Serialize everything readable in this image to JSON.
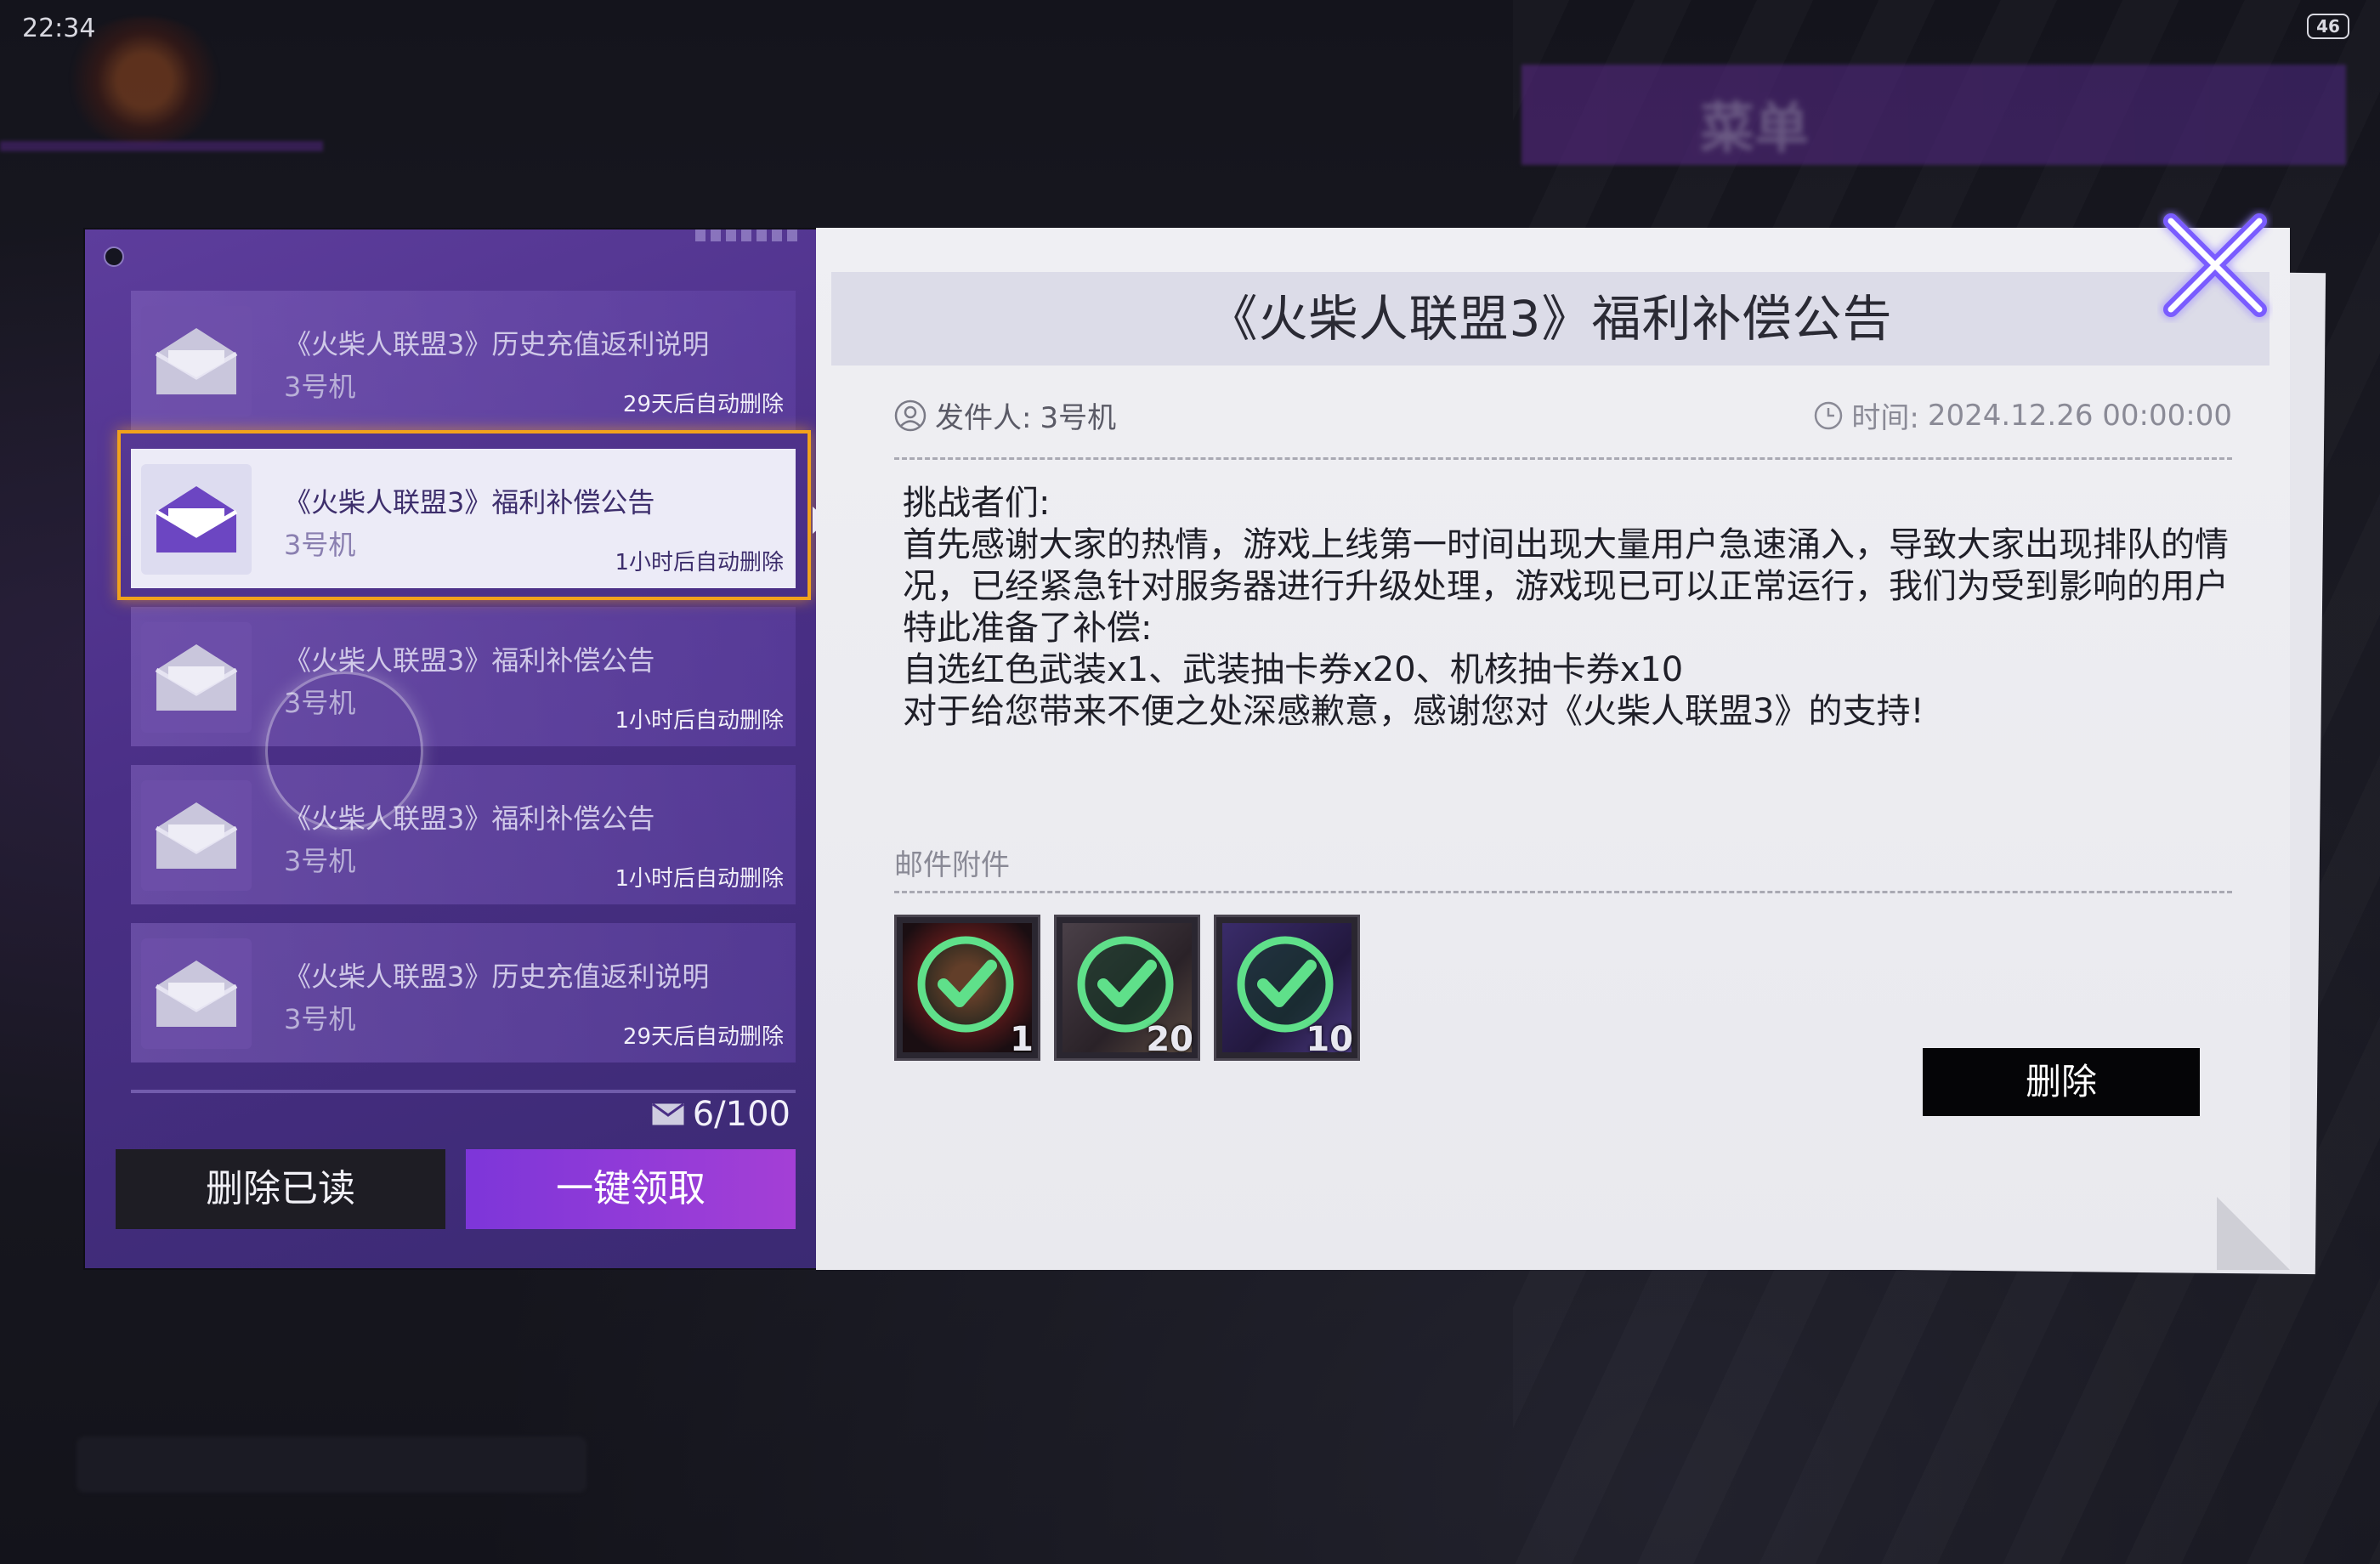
{
  "status": {
    "time": "22:34",
    "battery": "46"
  },
  "background": {
    "menu_banner_text": "菜单"
  },
  "mail_list": {
    "items": [
      {
        "title": "《火柴人联盟3》历史充值返利说明",
        "sender": "3号机",
        "expire": "29天后自动删除",
        "selected": false
      },
      {
        "title": "《火柴人联盟3》福利补偿公告",
        "sender": "3号机",
        "expire": "1小时后自动删除",
        "selected": true
      },
      {
        "title": "《火柴人联盟3》福利补偿公告",
        "sender": "3号机",
        "expire": "1小时后自动删除",
        "selected": false
      },
      {
        "title": "《火柴人联盟3》福利补偿公告",
        "sender": "3号机",
        "expire": "1小时后自动删除",
        "selected": false
      },
      {
        "title": "《火柴人联盟3》历史充值返利说明",
        "sender": "3号机",
        "expire": "29天后自动删除",
        "selected": false
      }
    ],
    "count": "6/100",
    "delete_read_label": "删除已读",
    "claim_all_label": "一键领取"
  },
  "detail": {
    "title": "《火柴人联盟3》福利补偿公告",
    "sender_label": "发件人:",
    "sender": "3号机",
    "time_label": "时间:",
    "time": "2024.12.26 00:00:00",
    "body": [
      "挑战者们:",
      "首先感谢大家的热情，游戏上线第一时间出现大量用户急速涌入，导致大家出现排队的情况，已经紧急针对服务器进行升级处理，游戏现已可以正常运行，我们为受到影响的用户特此准备了补偿:",
      "自选红色武装x1、武装抽卡券x20、机核抽卡券x10",
      "对于给您带来不便之处深感歉意，感谢您对《火柴人联盟3》的支持!"
    ],
    "attachments_label": "邮件附件",
    "attachments": [
      {
        "name": "自选红色武装",
        "qty": "1",
        "claimed": true
      },
      {
        "name": "武装抽卡券",
        "qty": "20",
        "claimed": true
      },
      {
        "name": "机核抽卡券",
        "qty": "10",
        "claimed": true
      }
    ],
    "delete_label": "删除"
  },
  "icons": {
    "close": "close-icon",
    "mail": "envelope-icon",
    "user": "user-icon",
    "clock": "clock-icon",
    "check": "check-icon"
  },
  "colors": {
    "accent_purple": "#7d36d9",
    "select_frame": "#f2a21c",
    "check_green": "#5fe08a"
  }
}
